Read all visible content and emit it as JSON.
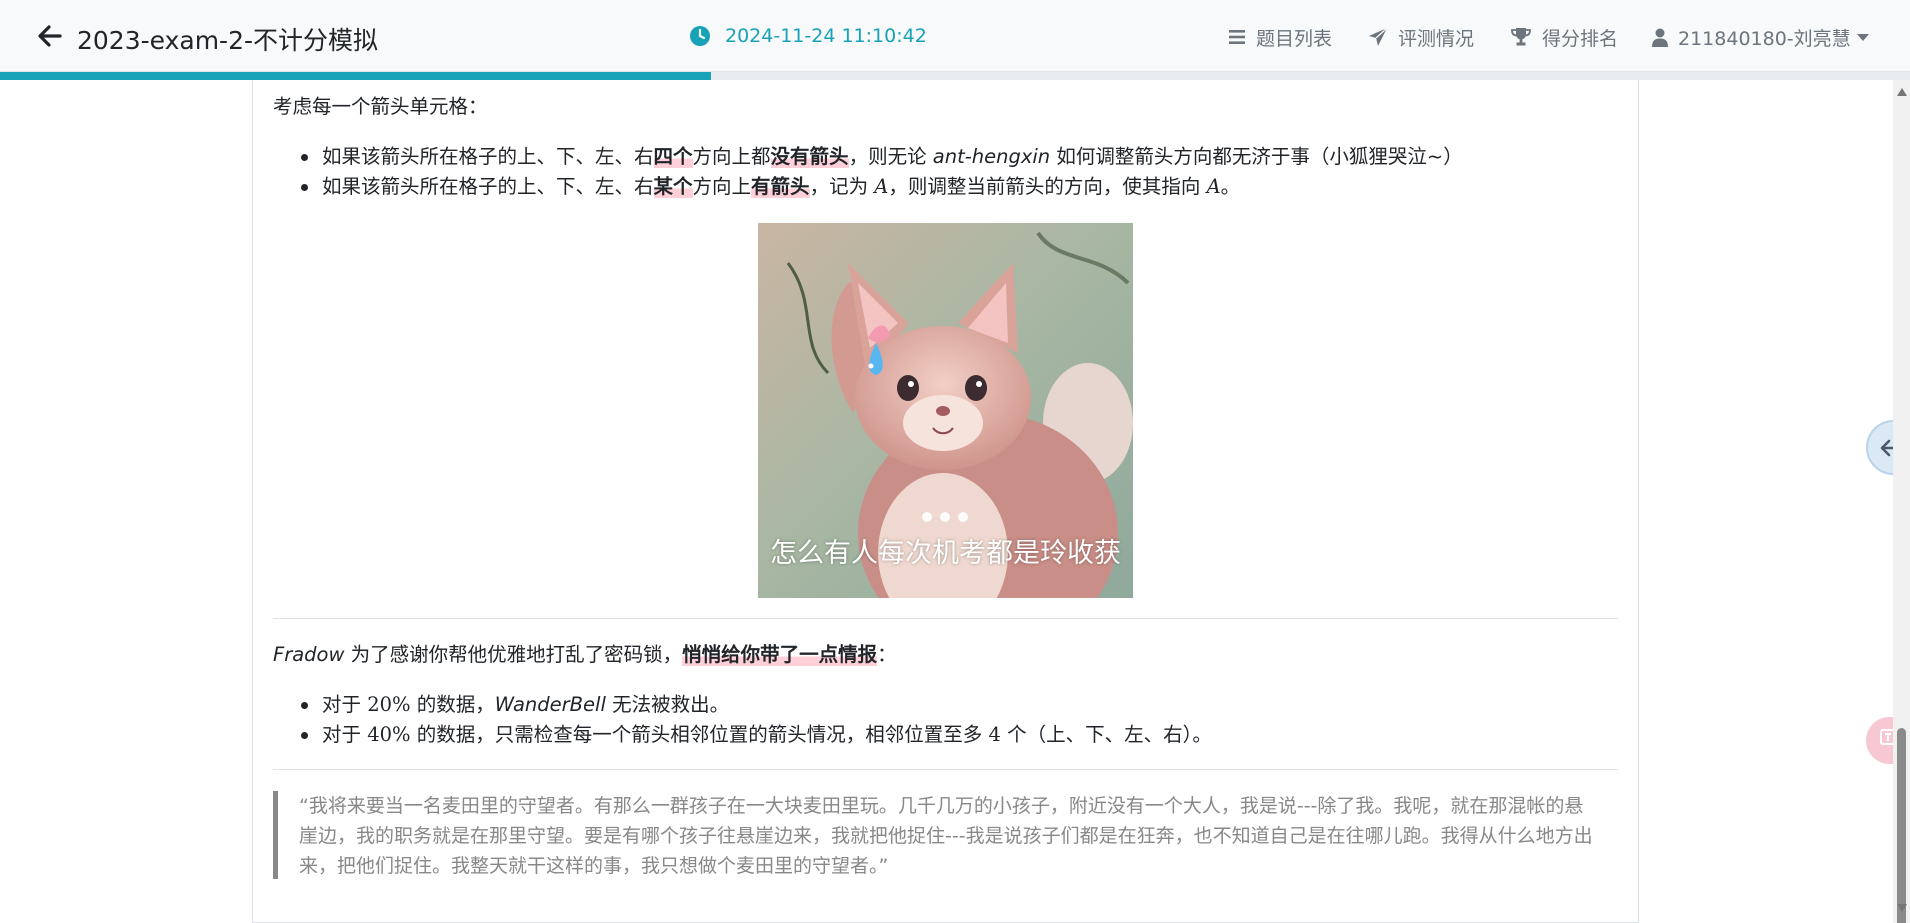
{
  "header": {
    "title": "2023-exam-2-不计分模拟",
    "timestamp": "2024-11-24 11:10:42",
    "nav": {
      "problems": "题目列表",
      "submissions": "评测情况",
      "ranking": "得分排名",
      "user": "211840180-刘亮慧"
    }
  },
  "progress": {
    "fraction": 0.372
  },
  "content": {
    "intro": "考虑每一个箭头单元格：",
    "rules": [
      {
        "a": "如果该箭头所在格子的上、下、左、右",
        "b": "四个",
        "c": "方向上都",
        "d": "没有箭头",
        "e": "，则无论 ",
        "f": "ant-hengxin",
        "g": " 如何调整箭头方向都无济于事（小狐狸哭泣~）"
      },
      {
        "a": "如果该箭头所在格子的上、下、左、右",
        "b": "某个",
        "c": "方向上",
        "d": "有箭头",
        "e": "，记为 ",
        "f": "A",
        "g": "，则调整当前箭头的方向，使其指向 ",
        "h": "A",
        "i": "。"
      }
    ],
    "image_caption": "怎么有人每次机考都是玲收获",
    "hint_name": "Fradow",
    "hint_text": " 为了感谢你帮他优雅地打乱了密码锁，",
    "hint_bold": "悄悄给你带了一点情报",
    "hint_colon": "：",
    "hints": [
      {
        "a": "对于 ",
        "pct": "20%",
        "b": " 的数据，",
        "name": "WanderBell",
        "c": " 无法被救出。"
      },
      {
        "a": "对于 ",
        "pct": "40%",
        "b": " 的数据，只需检查每一个箭头相邻位置的箭头情况，相邻位置至多 ",
        "n": "4",
        "c": " 个（上、下、左、右）。"
      }
    ],
    "quote": "“我将来要当一名麦田里的守望者。有那么一群孩子在一大块麦田里玩。几千几万的小孩子，附近没有一个大人，我是说---除了我。我呢，就在那混帐的悬崖边，我的职务就是在那里守望。要是有哪个孩子往悬崖边来，我就把他捉住---我是说孩子们都是在狂奔，也不知道自己是在往哪儿跑。我得从什么地方出来，把他们捉住。我整天就干这样的事，我只想做个麦田里的守望者。”"
  },
  "icons": [
    "arrow-left-icon",
    "clock-icon",
    "list-icon",
    "paper-plane-icon",
    "trophy-icon",
    "user-icon",
    "translate-icon"
  ],
  "colors": {
    "accent": "#17a2b8",
    "highlight": "#ffd0d8"
  }
}
